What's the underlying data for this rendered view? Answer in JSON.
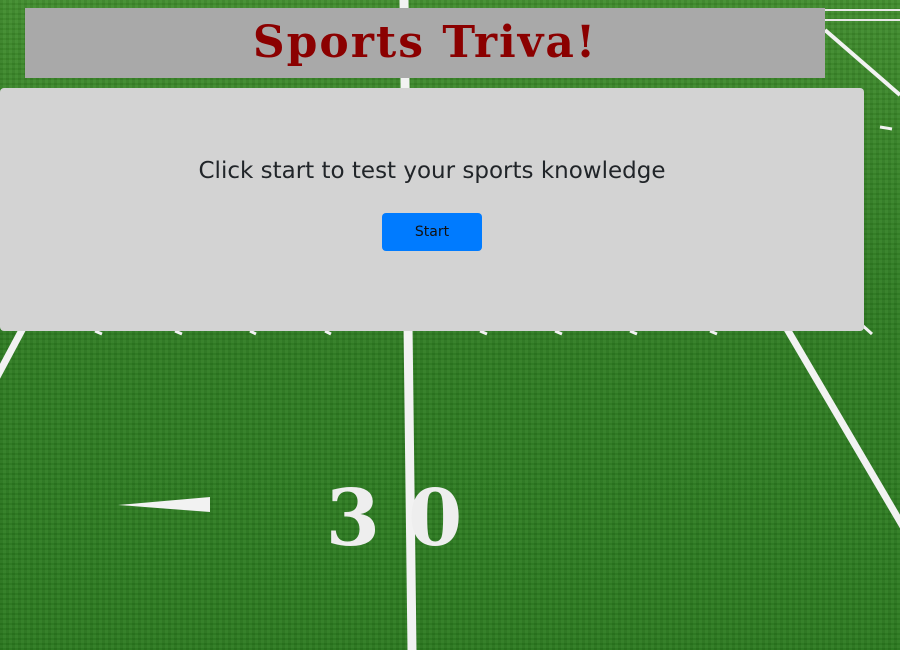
{
  "header": {
    "title": "Sports Triva!"
  },
  "main": {
    "prompt": "Click start to test your sports knowledge",
    "start_label": "Start"
  },
  "field": {
    "yard_marker": "30"
  },
  "colors": {
    "title_text": "#8b0000",
    "title_bar": "#a9a9a9",
    "card": "#d3d3d3",
    "start_button": "#007bff",
    "grass": "#2f7d22"
  }
}
